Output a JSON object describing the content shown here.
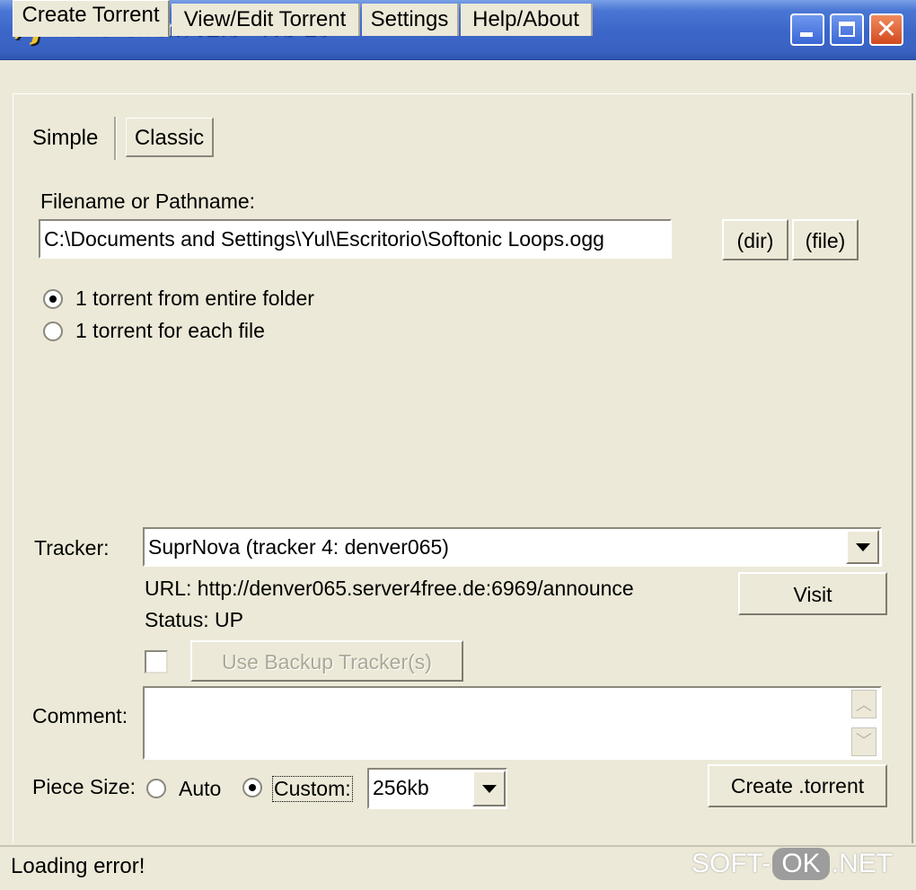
{
  "window": {
    "title": "MakeTorrent v2.0 - RC 1c"
  },
  "main_tabs": [
    {
      "label": "Create Torrent"
    },
    {
      "label": "View/Edit Torrent"
    },
    {
      "label": "Settings"
    },
    {
      "label": "Help/About"
    }
  ],
  "mode_tabs": {
    "simple": "Simple",
    "classic": "Classic",
    "selected": "Classic"
  },
  "file": {
    "label": "Filename or Pathname:",
    "value": "C:\\Documents and Settings\\Yul\\Escritorio\\Softonic Loops.ogg",
    "dir_button": "(dir)",
    "file_button": "(file)"
  },
  "torrent_mode": {
    "option1": "1 torrent from entire folder",
    "option2": "1 torrent for each file",
    "selected": "1 torrent from entire folder"
  },
  "tracker": {
    "label": "Tracker:",
    "selected": "SuprNova (tracker 4: denver065)",
    "url_text": "URL: http://denver065.server4free.de:6969/announce",
    "status_text": "Status: UP",
    "visit_button": "Visit",
    "backup_label": "Use Backup Tracker(s)",
    "backup_checked": false
  },
  "comment": {
    "label": "Comment:",
    "value": ""
  },
  "piece_size": {
    "label": "Piece Size:",
    "auto_label": "Auto",
    "custom_label": "Custom:",
    "selected_mode": "Custom:",
    "value": "256kb"
  },
  "create_button": "Create .torrent",
  "status_bar": {
    "text": "Loading error!"
  },
  "watermark": {
    "left": "SOFT-",
    "box": "OK",
    "right": ".NET"
  },
  "icons": [
    "app-icon",
    "minimize-icon",
    "maximize-icon",
    "close-icon",
    "chevron-down-icon",
    "scroll-up-icon",
    "scroll-down-icon"
  ]
}
